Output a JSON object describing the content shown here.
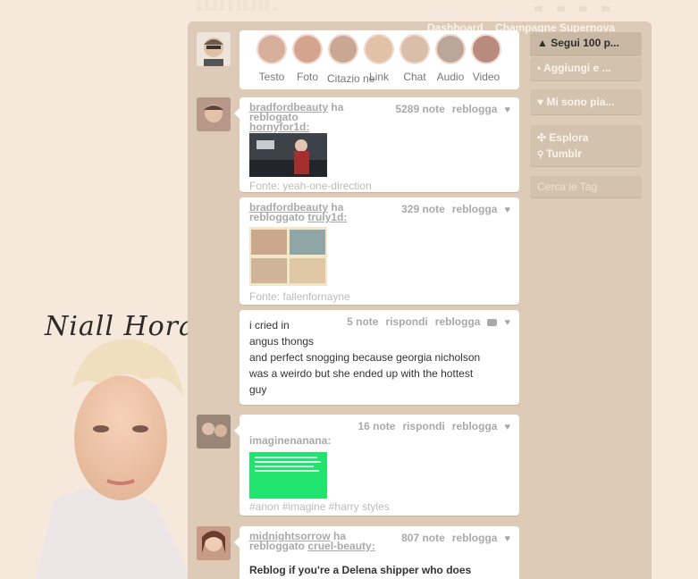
{
  "logo": "tumblr.",
  "nav": {
    "dashboard": "Dashboard",
    "blog": "Champagne Supernova"
  },
  "post_types": [
    {
      "label": "Testo"
    },
    {
      "label": "Foto"
    },
    {
      "label": "Citazio ne"
    },
    {
      "label": "Link"
    },
    {
      "label": "Chat"
    },
    {
      "label": "Audio"
    },
    {
      "label": "Video"
    }
  ],
  "posts": [
    {
      "user": "bradfordbeauty",
      "action": "ha",
      "reblogged": "reblogato",
      "from": "hornyfor1d:",
      "notes": "5289 note",
      "reblog": "reblogga",
      "source": "Fonte: yeah-one-direction"
    },
    {
      "user": "bradfordbeauty",
      "action": "ha",
      "reblogged": "rebloggato",
      "from": "truly1d:",
      "notes": "329 note",
      "reblog": "reblogga",
      "source": "Fonte: fallenfornayne"
    },
    {
      "text": "i cried in\nangus thongs\nand perfect snogging because georgia nicholson\nwas a weirdo but she ended up with the hottest\nguy",
      "notes": "5 note",
      "reply": "rispondi",
      "reblog": "reblogga"
    },
    {
      "user": "imaginenanana:",
      "notes": "16 note",
      "reply": "rispondi",
      "reblog": "reblogga",
      "tags": "#anon  #imagine  #harry styles"
    },
    {
      "user": "midnightsorrow",
      "action": "ha",
      "reblogged": "rebloggato",
      "from": "cruel-beauty:",
      "notes": "807 note",
      "reblog": "reblogga",
      "text": "Reblog if you're a Delena shipper who does"
    }
  ],
  "sidebar": {
    "follow": "Segui 100 p...",
    "add": "Aggiungi e ...",
    "likes": "Mi sono pia...",
    "explore1": "Esplora",
    "explore2": "Tumblr",
    "tags": "Cerca le Tag"
  },
  "bg_text": "Niall Horan",
  "colors": {
    "bg": "#f6e9dc",
    "panel": "#ddcbb7",
    "sidebar": "#d3c2ae"
  }
}
